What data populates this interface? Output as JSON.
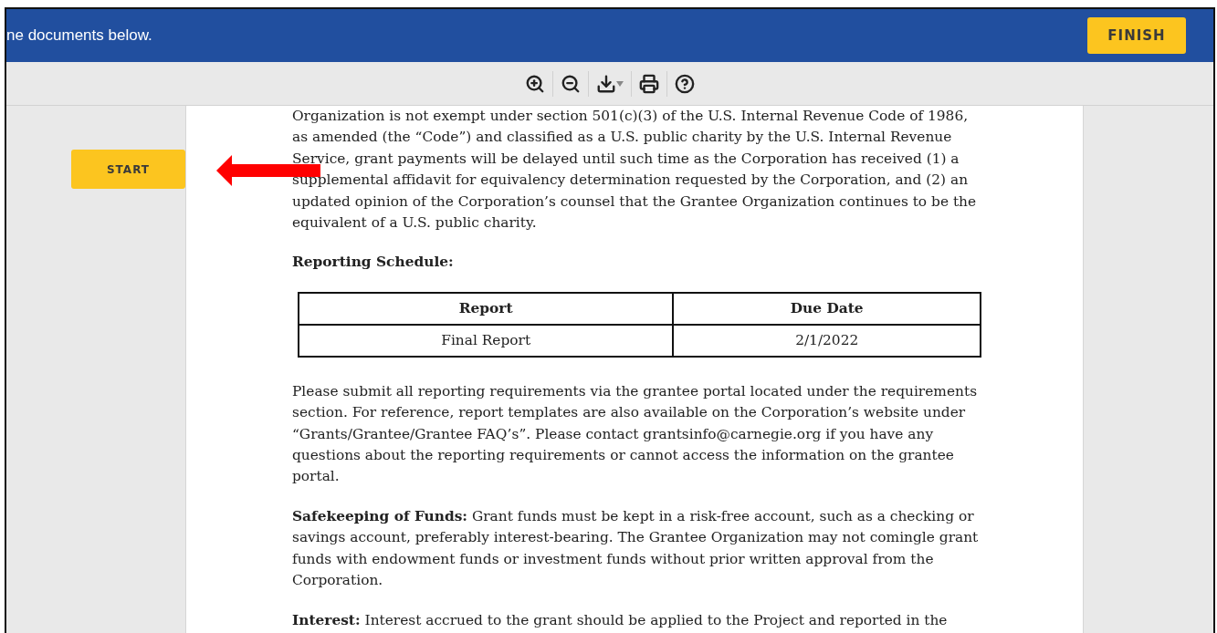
{
  "header": {
    "message": "ne documents below.",
    "finish_button": "FINISH"
  },
  "toolbar": {
    "tools": [
      {
        "kind": "zoom-in"
      },
      {
        "kind": "zoom-out"
      },
      {
        "kind": "download"
      },
      {
        "kind": "print"
      },
      {
        "kind": "help"
      }
    ]
  },
  "sidebar": {
    "start_button": "START"
  },
  "annotation": {
    "kind": "arrow"
  },
  "document": {
    "blocks": [
      {
        "kind": "paragraph",
        "text": "Organization is not exempt under section 501(c)(3) of the U.S. Internal Revenue Code of 1986, as amended (the “Code”) and classified as a U.S. public charity by the U.S. Internal Revenue Service, grant payments will be delayed until such time as the Corporation has received (1) a supplemental affidavit for equivalency determination requested by the Corporation, and (2) an updated opinion of the Corporation’s counsel that the Grantee Organization continues to be the equivalent of a U.S. public charity."
      },
      {
        "kind": "heading",
        "text": "Reporting Schedule:"
      },
      {
        "kind": "table",
        "columns": [
          "Report",
          "Due Date"
        ],
        "rows": [
          [
            "Final Report",
            "2/1/2022"
          ]
        ]
      },
      {
        "kind": "paragraph",
        "text": "Please submit all reporting requirements via the grantee portal located under the requirements section. For reference, report templates are also available on the Corporation’s website under “Grants/Grantee/Grantee FAQ’s”. Please contact grantsinfo@carnegie.org if you have any questions about the reporting requirements or cannot access the information on the grantee portal."
      },
      {
        "kind": "paragraph",
        "text": "**Safekeeping of Funds:** Grant funds must be kept in a risk-free account, such as a checking or savings account, preferably interest-bearing. The Grantee Organization may not comingle grant funds with endowment funds or investment funds without prior written approval from the Corporation."
      },
      {
        "kind": "paragraph",
        "text": "**Interest:** Interest accrued to the grant should be applied to the Project and reported in the"
      }
    ]
  }
}
